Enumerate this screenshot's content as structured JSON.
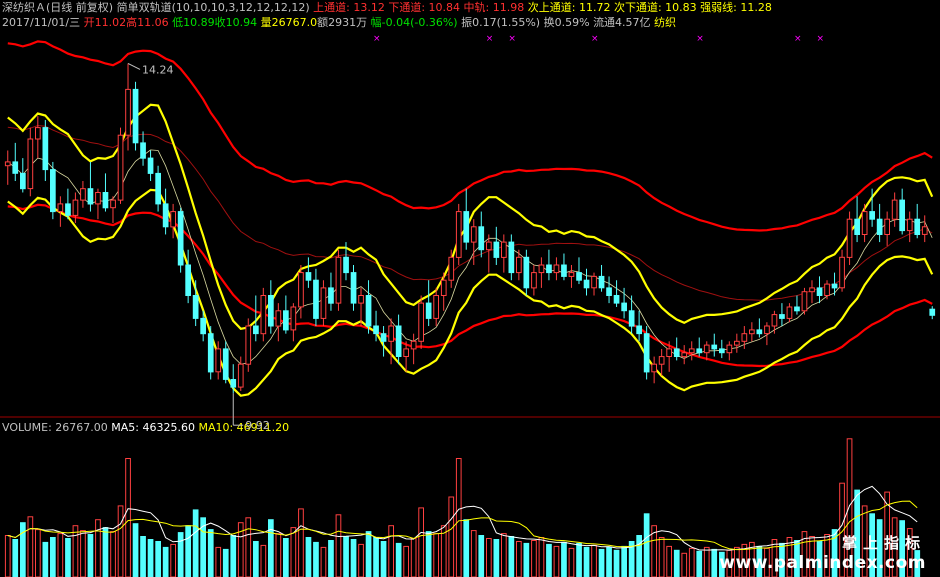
{
  "header": {
    "title": "深纺织Ａ(日线 前复权)",
    "indicator_name": "简单双轨道(10,10,10,3,12,12,12,12)",
    "upper_channel_label": "上通道: 13.12",
    "lower_channel_label": "下通道: 10.84",
    "mid_label": "中轨: 11.98",
    "sub_upper_label": "次上通道: 11.72",
    "sub_lower_label": "次下通道: 10.83",
    "strength_label": "强弱线: 11.28"
  },
  "quote": {
    "date": "2017/11/01/三",
    "open": "开11.02",
    "high": "高11.06",
    "low": "低10.89",
    "close": "收10.94",
    "volume": "量26767.0",
    "amount": "额2931万",
    "change": "幅-0.04(-0.36%)",
    "amplitude": "振0.17(1.55%)",
    "turnover": "换0.59%",
    "float_cap": "流通4.57亿",
    "industry": "纺织"
  },
  "volume_header": {
    "volume": "VOLUME: 26767.00",
    "ma5": "MA5: 46325.60",
    "ma10": "MA10: 46911.20"
  },
  "annotations": {
    "high_price": "14.24",
    "low_price": "9.92"
  },
  "watermark": {
    "line1": "掌上指标",
    "line2": "www.palmindex.com"
  },
  "colors": {
    "background": "#000000",
    "up_candle": "#ff4040",
    "down_candle": "#54ffff",
    "yellow_band": "#ffff00",
    "red_band": "#ff0000",
    "dark_red_line": "#a01010",
    "ma5_line": "#ffffff",
    "ma10_line": "#ffff00",
    "marker": "#ff00ff",
    "header_red": "#ff3030",
    "header_green": "#00e000",
    "header_yellow": "#ffff00",
    "header_gray": "#c0c0c0"
  },
  "chart_data": {
    "type": "candlestick",
    "price_range": [
      9.7,
      14.6
    ],
    "candles": [
      [
        12.9,
        13.1,
        12.65,
        12.95
      ],
      [
        12.95,
        13.2,
        12.7,
        12.8
      ],
      [
        12.8,
        13.0,
        12.55,
        12.6
      ],
      [
        12.6,
        13.4,
        12.5,
        13.25
      ],
      [
        13.25,
        13.55,
        13.0,
        13.4
      ],
      [
        13.4,
        13.5,
        12.7,
        12.85
      ],
      [
        12.85,
        12.95,
        12.2,
        12.3
      ],
      [
        12.3,
        12.5,
        12.1,
        12.4
      ],
      [
        12.4,
        12.6,
        12.2,
        12.25
      ],
      [
        12.25,
        12.55,
        12.15,
        12.45
      ],
      [
        12.45,
        12.7,
        12.35,
        12.6
      ],
      [
        12.6,
        12.95,
        12.3,
        12.4
      ],
      [
        12.4,
        12.6,
        12.2,
        12.55
      ],
      [
        12.55,
        12.8,
        12.3,
        12.35
      ],
      [
        12.35,
        12.5,
        12.15,
        12.45
      ],
      [
        12.45,
        13.4,
        12.4,
        13.3
      ],
      [
        13.3,
        14.24,
        13.1,
        13.9
      ],
      [
        13.9,
        14.0,
        13.1,
        13.2
      ],
      [
        13.2,
        13.35,
        12.9,
        13.0
      ],
      [
        13.0,
        13.1,
        12.7,
        12.8
      ],
      [
        12.8,
        12.9,
        12.3,
        12.4
      ],
      [
        12.4,
        12.6,
        12.0,
        12.1
      ],
      [
        12.1,
        12.4,
        11.95,
        12.3
      ],
      [
        12.3,
        12.35,
        11.5,
        11.6
      ],
      [
        11.6,
        11.8,
        11.1,
        11.2
      ],
      [
        11.2,
        11.4,
        10.8,
        10.9
      ],
      [
        10.9,
        11.0,
        10.6,
        10.7
      ],
      [
        10.7,
        10.8,
        10.1,
        10.2
      ],
      [
        10.2,
        10.6,
        10.1,
        10.5
      ],
      [
        10.5,
        10.6,
        10.05,
        10.1
      ],
      [
        10.1,
        10.3,
        9.92,
        10.0
      ],
      [
        10.0,
        10.4,
        9.95,
        10.3
      ],
      [
        10.3,
        10.9,
        10.2,
        10.8
      ],
      [
        10.8,
        11.2,
        10.6,
        10.7
      ],
      [
        10.7,
        11.3,
        10.6,
        11.2
      ],
      [
        11.2,
        11.4,
        10.7,
        10.8
      ],
      [
        10.8,
        11.1,
        10.6,
        11.0
      ],
      [
        11.0,
        11.2,
        10.7,
        10.75
      ],
      [
        10.75,
        11.1,
        10.6,
        11.05
      ],
      [
        11.05,
        11.6,
        10.9,
        11.5
      ],
      [
        11.5,
        11.7,
        11.3,
        11.4
      ],
      [
        11.4,
        11.55,
        10.8,
        10.9
      ],
      [
        10.9,
        11.4,
        10.8,
        11.3
      ],
      [
        11.3,
        11.5,
        11.0,
        11.1
      ],
      [
        11.1,
        11.8,
        11.0,
        11.7
      ],
      [
        11.7,
        11.9,
        11.4,
        11.5
      ],
      [
        11.5,
        11.6,
        11.0,
        11.1
      ],
      [
        11.1,
        11.3,
        10.8,
        11.2
      ],
      [
        11.2,
        11.4,
        10.7,
        10.8
      ],
      [
        10.8,
        11.0,
        10.6,
        10.7
      ],
      [
        10.7,
        10.8,
        10.4,
        10.6
      ],
      [
        10.6,
        10.9,
        10.3,
        10.8
      ],
      [
        10.8,
        10.95,
        10.3,
        10.4
      ],
      [
        10.4,
        10.6,
        10.2,
        10.5
      ],
      [
        10.5,
        10.7,
        10.3,
        10.6
      ],
      [
        10.6,
        11.2,
        10.5,
        11.1
      ],
      [
        11.1,
        11.4,
        10.8,
        10.9
      ],
      [
        10.9,
        11.3,
        10.8,
        11.2
      ],
      [
        11.2,
        11.5,
        11.0,
        11.4
      ],
      [
        11.4,
        11.8,
        11.3,
        11.7
      ],
      [
        11.7,
        12.4,
        11.6,
        12.3
      ],
      [
        12.3,
        12.6,
        11.8,
        11.9
      ],
      [
        11.9,
        12.2,
        11.6,
        12.1
      ],
      [
        12.1,
        12.3,
        11.7,
        11.8
      ],
      [
        11.8,
        12.0,
        11.5,
        11.9
      ],
      [
        11.9,
        12.1,
        11.6,
        11.7
      ],
      [
        11.7,
        12.0,
        11.5,
        11.9
      ],
      [
        11.9,
        12.0,
        11.4,
        11.5
      ],
      [
        11.5,
        11.8,
        11.4,
        11.7
      ],
      [
        11.7,
        11.8,
        11.2,
        11.3
      ],
      [
        11.3,
        11.6,
        11.2,
        11.5
      ],
      [
        11.5,
        11.7,
        11.3,
        11.6
      ],
      [
        11.6,
        11.8,
        11.4,
        11.5
      ],
      [
        11.5,
        11.7,
        11.4,
        11.6
      ],
      [
        11.6,
        11.75,
        11.4,
        11.45
      ],
      [
        11.45,
        11.6,
        11.3,
        11.5
      ],
      [
        11.5,
        11.7,
        11.35,
        11.4
      ],
      [
        11.4,
        11.55,
        11.2,
        11.3
      ],
      [
        11.3,
        11.5,
        11.2,
        11.45
      ],
      [
        11.45,
        11.6,
        11.25,
        11.3
      ],
      [
        11.3,
        11.45,
        11.1,
        11.2
      ],
      [
        11.2,
        11.4,
        11.05,
        11.1
      ],
      [
        11.1,
        11.3,
        10.9,
        11.0
      ],
      [
        11.0,
        11.2,
        10.7,
        10.8
      ],
      [
        10.8,
        11.0,
        10.6,
        10.7
      ],
      [
        10.7,
        10.8,
        10.1,
        10.2
      ],
      [
        10.2,
        10.4,
        10.05,
        10.3
      ],
      [
        10.3,
        10.5,
        10.15,
        10.4
      ],
      [
        10.4,
        10.6,
        10.2,
        10.5
      ],
      [
        10.5,
        10.65,
        10.35,
        10.4
      ],
      [
        10.4,
        10.55,
        10.3,
        10.45
      ],
      [
        10.45,
        10.6,
        10.35,
        10.5
      ],
      [
        10.5,
        10.65,
        10.4,
        10.45
      ],
      [
        10.45,
        10.6,
        10.35,
        10.55
      ],
      [
        10.55,
        10.7,
        10.4,
        10.5
      ],
      [
        10.5,
        10.62,
        10.38,
        10.45
      ],
      [
        10.45,
        10.6,
        10.35,
        10.55
      ],
      [
        10.55,
        10.7,
        10.45,
        10.6
      ],
      [
        10.6,
        10.8,
        10.5,
        10.7
      ],
      [
        10.7,
        10.85,
        10.6,
        10.75
      ],
      [
        10.75,
        10.9,
        10.65,
        10.7
      ],
      [
        10.7,
        10.85,
        10.55,
        10.8
      ],
      [
        10.8,
        11.0,
        10.7,
        10.95
      ],
      [
        10.95,
        11.1,
        10.8,
        10.9
      ],
      [
        10.9,
        11.1,
        10.85,
        11.05
      ],
      [
        11.05,
        11.2,
        10.95,
        11.0
      ],
      [
        11.0,
        11.3,
        10.95,
        11.25
      ],
      [
        11.25,
        11.4,
        11.1,
        11.3
      ],
      [
        11.3,
        11.45,
        11.1,
        11.2
      ],
      [
        11.2,
        11.4,
        11.15,
        11.35
      ],
      [
        11.35,
        11.5,
        11.2,
        11.3
      ],
      [
        11.3,
        11.8,
        11.25,
        11.7
      ],
      [
        11.7,
        12.3,
        11.6,
        12.2
      ],
      [
        12.2,
        12.5,
        11.9,
        12.0
      ],
      [
        12.0,
        12.4,
        11.9,
        12.3
      ],
      [
        12.3,
        12.6,
        12.1,
        12.2
      ],
      [
        12.2,
        12.4,
        11.9,
        12.0
      ],
      [
        12.0,
        12.3,
        11.85,
        12.2
      ],
      [
        12.2,
        12.55,
        12.1,
        12.45
      ],
      [
        12.45,
        12.6,
        12.0,
        12.05
      ],
      [
        12.05,
        12.3,
        11.9,
        12.2
      ],
      [
        12.2,
        12.4,
        11.95,
        12.0
      ],
      [
        12.0,
        12.25,
        11.9,
        12.1
      ],
      [
        11.02,
        11.06,
        10.89,
        10.94
      ]
    ],
    "volumes": [
      42000,
      38000,
      55000,
      61000,
      48000,
      35000,
      40000,
      44000,
      39000,
      52000,
      47000,
      43000,
      58000,
      50000,
      46000,
      72000,
      120000,
      54000,
      41000,
      38000,
      36000,
      30000,
      33000,
      45000,
      52000,
      68000,
      60000,
      48000,
      30000,
      28000,
      42000,
      55000,
      60000,
      36000,
      32000,
      58000,
      44000,
      39000,
      50000,
      69000,
      40000,
      35000,
      30000,
      37000,
      63000,
      41000,
      38000,
      33000,
      46000,
      40000,
      36000,
      52000,
      34000,
      31000,
      39000,
      70000,
      46000,
      44000,
      52000,
      81000,
      120000,
      58000,
      47000,
      42000,
      39000,
      38000,
      44000,
      41000,
      36000,
      34000,
      37000,
      40000,
      33000,
      31000,
      35000,
      29000,
      34000,
      30000,
      32000,
      28000,
      30000,
      27000,
      31000,
      36000,
      42000,
      64000,
      52000,
      40000,
      31000,
      27000,
      24000,
      29000,
      26000,
      30000,
      28000,
      25000,
      27000,
      30000,
      33000,
      35000,
      31000,
      29000,
      38000,
      34000,
      40000,
      37000,
      46000,
      41000,
      36000,
      43000,
      48000,
      95000,
      140000,
      88000,
      72000,
      64000,
      58000,
      86000,
      60000,
      57000,
      49000,
      26767
    ],
    "ma5": [
      46325.6
    ],
    "ma10": [
      46911.2
    ],
    "last_values": {
      "upper_channel": 13.12,
      "lower_channel": 10.84,
      "mid": 11.98,
      "sub_upper": 11.72,
      "sub_lower": 10.83,
      "strength": 11.28
    },
    "marked_high": 14.24,
    "marked_low": 9.92
  }
}
